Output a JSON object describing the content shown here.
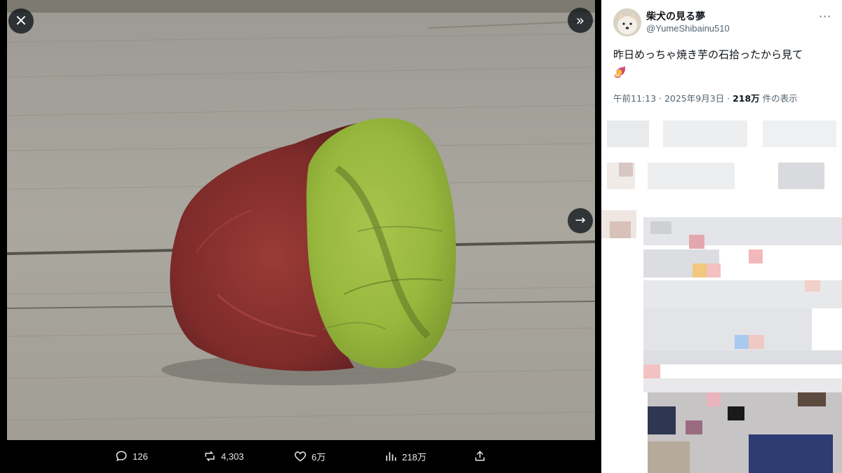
{
  "viewer": {
    "close_label": "×",
    "collapse_label": "»",
    "next_label": "→"
  },
  "actions": {
    "replies": "126",
    "reposts": "4,303",
    "likes": "6万",
    "views": "218万"
  },
  "tweet": {
    "display_name": "柴犬の見る夢",
    "handle": "@YumeShibainu510",
    "text": "昨日めっちゃ焼き芋の石拾ったから見て",
    "emoji": "🍠",
    "time": "午前11:13 · 2025年9月3日 · ",
    "views_count": "218万",
    "views_suffix": " 件の表示"
  },
  "icons": [
    "close-icon",
    "collapse-icon",
    "next-arrow-icon",
    "reply-icon",
    "repost-icon",
    "like-icon",
    "views-icon",
    "share-icon",
    "more-icon"
  ]
}
